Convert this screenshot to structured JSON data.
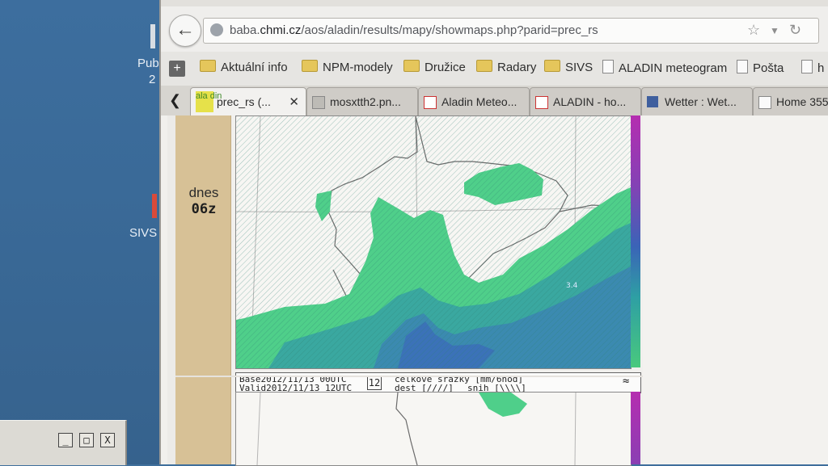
{
  "desktop": {
    "icon1_label": "Pub",
    "icon1_sub": "2",
    "icon2_label": "SIVS",
    "window_controls": [
      "_",
      "□",
      "X"
    ]
  },
  "browser": {
    "url": {
      "prefix": "baba.",
      "domain": "chmi.cz",
      "path": "/aos/aladin/results/mapy/showmaps.php?parid=prec_rs"
    },
    "bookmarks": [
      "Aktuální info",
      "NPM-modely",
      "Družice",
      "Radary",
      "SIVS",
      "ALADIN meteogram",
      "Pošta",
      "h"
    ],
    "tabs": [
      "prec_rs (...",
      "mosxtth2.pn...",
      "Aladin Meteo...",
      "ALADIN - ho...",
      "Wetter : Wet...",
      "Home 355..."
    ],
    "tab_favicon_text": "ala din"
  },
  "page": {
    "day_label": "dnes",
    "time_label": "06z",
    "info": {
      "base": "Base2012/11/13 00UTC",
      "valid": "Valid2012/11/13 12UTC",
      "step": "12",
      "desc": "celkove srazky [mm/6hod]",
      "rain": "dest [////]",
      "snow": "snih [\\\\\\\\]"
    },
    "map_value": "3.4"
  },
  "colors": {
    "precip_light": "#4fcf8a",
    "precip_mid": "#3aa8a0",
    "precip_dark": "#3b72b8",
    "stripe": "#d7c196",
    "desktop": "#3d6e9e"
  }
}
